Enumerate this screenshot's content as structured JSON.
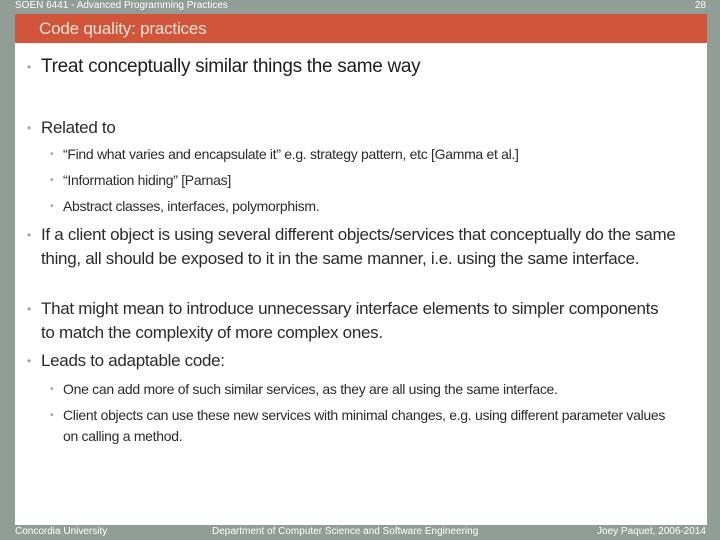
{
  "header": {
    "course": "SOEN 6441 - Advanced Programming Practices",
    "page_number": "28",
    "title": "Code quality: practices"
  },
  "colors": {
    "background": "#919e95",
    "title_bar": "#d0553a",
    "panel": "#ffffff"
  },
  "content": {
    "bullets": [
      {
        "text": "Treat conceptually similar things the same way"
      },
      {
        "text": "Related to",
        "sub": [
          "“Find what varies and encapsulate it” e.g. strategy pattern, etc [Gamma et al.]",
          "“Information hiding” [Parnas]",
          "Abstract classes, interfaces, polymorphism."
        ]
      },
      {
        "text": "If a client object is using several different objects/services that conceptually do the same thing, all should be exposed to it in the same manner, i.e. using the same interface."
      },
      {
        "text": "That might mean to introduce unnecessary interface elements to simpler components to match the complexity of more complex ones."
      },
      {
        "text": "Leads to adaptable code:",
        "sub": [
          "One can add more of such similar services, as they are all using the same interface.",
          "Client objects can use these new services with minimal changes, e.g. using different parameter values on calling a method."
        ]
      }
    ],
    "bullet_glyph": "•"
  },
  "footer": {
    "left": "Concordia University",
    "center": "Department of Computer Science and Software Engineering",
    "right": "Joey Paquet, 2006-2014"
  }
}
